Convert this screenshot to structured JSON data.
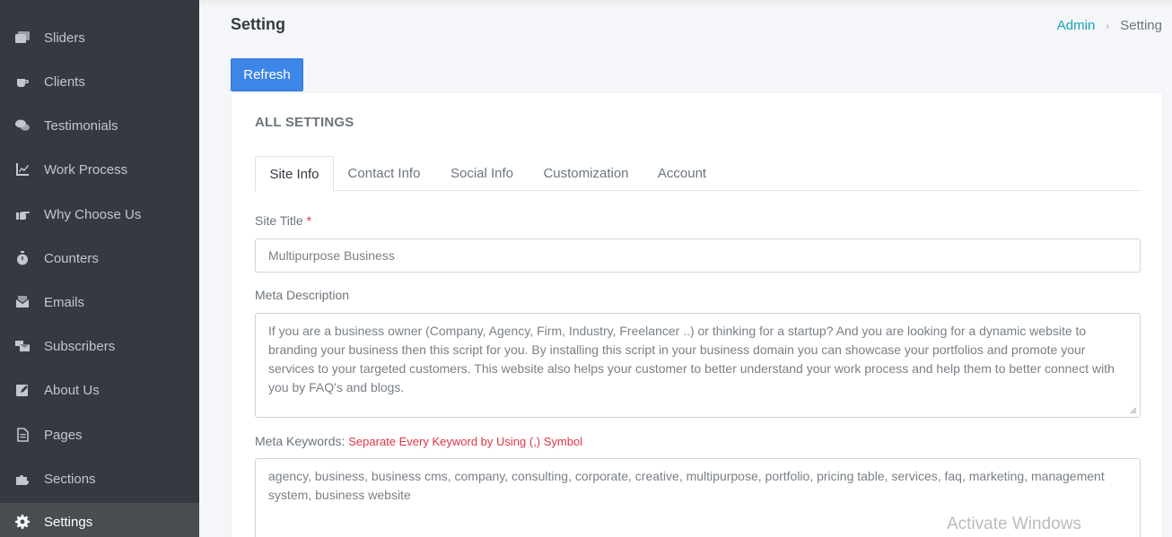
{
  "sidebar": {
    "items": [
      {
        "label": "Sliders",
        "icon": "images-icon"
      },
      {
        "label": "Clients",
        "icon": "coffee-icon"
      },
      {
        "label": "Testimonials",
        "icon": "comments-icon"
      },
      {
        "label": "Work Process",
        "icon": "chart-line-icon"
      },
      {
        "label": "Why Choose Us",
        "icon": "hand-point-icon"
      },
      {
        "label": "Counters",
        "icon": "stopwatch-icon"
      },
      {
        "label": "Emails",
        "icon": "mail-bulk-icon"
      },
      {
        "label": "Subscribers",
        "icon": "mail-stack-icon"
      },
      {
        "label": "About Us",
        "icon": "edit-icon"
      },
      {
        "label": "Pages",
        "icon": "file-icon"
      },
      {
        "label": "Sections",
        "icon": "puzzle-icon"
      },
      {
        "label": "Settings",
        "icon": "gear-icon",
        "active": true
      }
    ]
  },
  "header": {
    "title": "Setting",
    "breadcrumb": {
      "root": "Admin",
      "current": "Setting"
    }
  },
  "toolbar": {
    "refresh_label": "Refresh"
  },
  "card": {
    "title": "ALL SETTINGS",
    "tabs": [
      "Site Info",
      "Contact Info",
      "Social Info",
      "Customization",
      "Account"
    ],
    "active_tab": "Site Info"
  },
  "form": {
    "site_title": {
      "label": "Site Title",
      "required_mark": "*",
      "value": "Multipurpose Business"
    },
    "meta_description": {
      "label": "Meta Description",
      "value": "If you are a business owner (Company, Agency, Firm, Industry, Freelancer ..) or thinking for a startup? And you are looking for a dynamic website to branding your business then this script for you. By installing this script in your business domain you can showcase your portfolios and promote your services to your targeted customers. This website also helps your customer to better understand your work process and help them to better connect with you by FAQ's and blogs."
    },
    "meta_keywords": {
      "label": "Meta Keywords:",
      "hint": "Separate Every Keyword by Using (,) Symbol",
      "value": "agency, business, business cms, company, consulting, corporate, creative, multipurpose, portfolio, pricing table, services, faq, marketing, management system, business website"
    }
  },
  "overlay": {
    "watermark": "Activate Windows"
  },
  "colors": {
    "sidebar_bg": "#343a40",
    "sidebar_active": "#494e53",
    "primary": "#3d85e6",
    "link": "#17a2b8",
    "required": "#dc3545"
  }
}
